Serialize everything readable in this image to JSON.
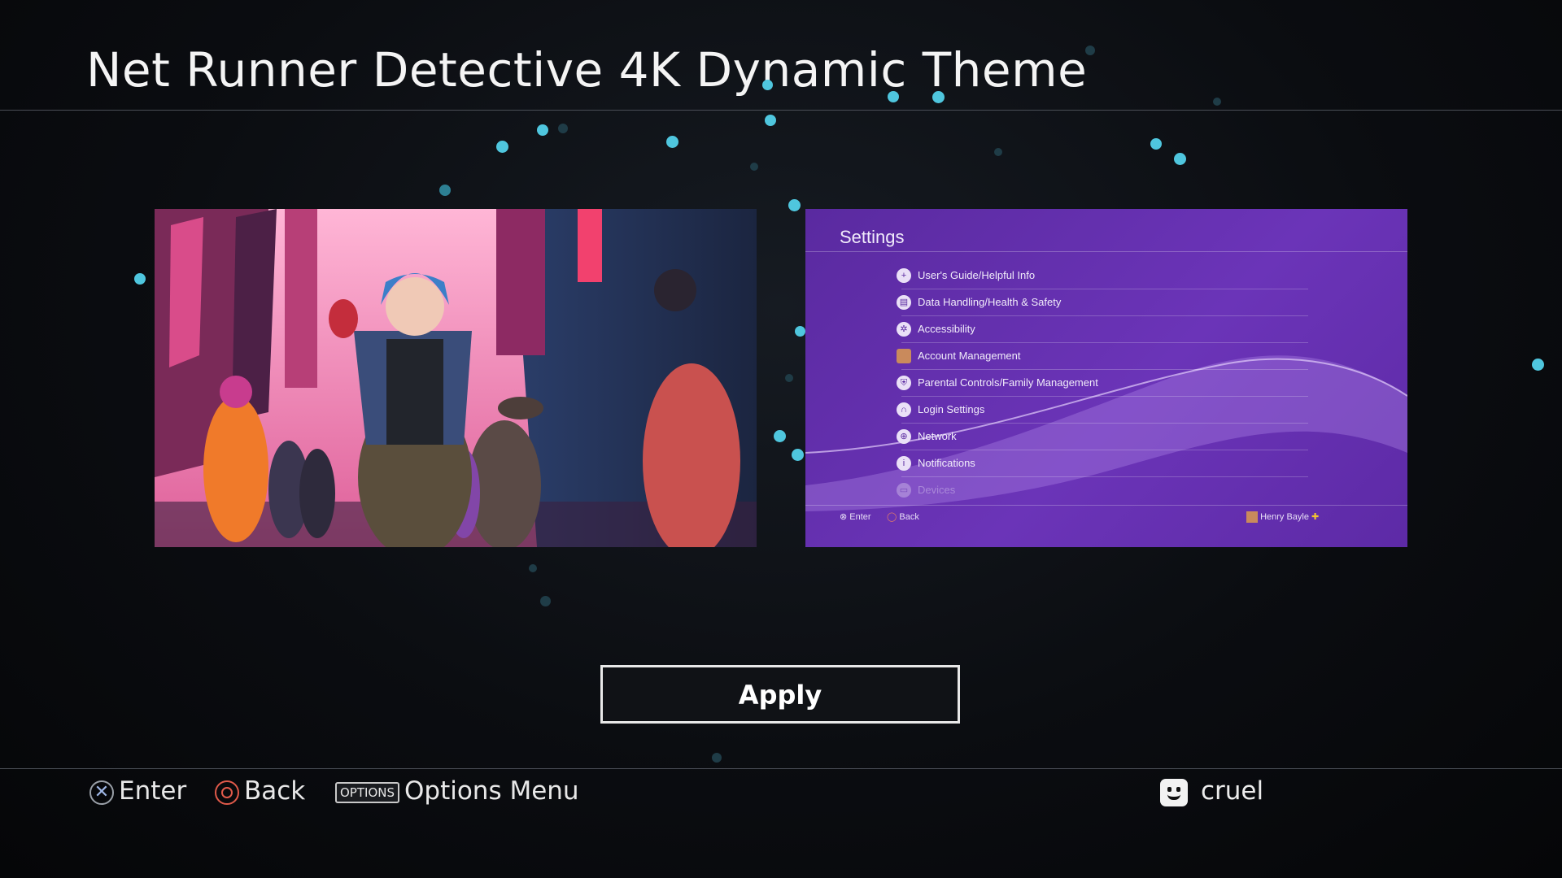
{
  "header": {
    "title": "Net Runner Detective 4K Dynamic Theme"
  },
  "preview": {
    "title": "Settings",
    "items": [
      {
        "icon": "users-guide-icon",
        "label": "User's Guide/Helpful Info"
      },
      {
        "icon": "data-handling-icon",
        "label": "Data Handling/Health & Safety"
      },
      {
        "icon": "accessibility-icon",
        "label": "Accessibility"
      },
      {
        "icon": "account-icon",
        "label": "Account Management"
      },
      {
        "icon": "parental-controls-icon",
        "label": "Parental Controls/Family Management"
      },
      {
        "icon": "login-icon",
        "label": "Login Settings"
      },
      {
        "icon": "network-icon",
        "label": "Network"
      },
      {
        "icon": "notifications-icon",
        "label": "Notifications"
      },
      {
        "icon": "devices-icon",
        "label": "Devices"
      }
    ],
    "footer": {
      "enter": "Enter",
      "back": "Back",
      "user": "Henry Bayle"
    }
  },
  "actions": {
    "apply_label": "Apply"
  },
  "footer": {
    "enter_label": "Enter",
    "back_label": "Back",
    "options_glyph": "OPTIONS",
    "options_label": "Options Menu",
    "username": "cruel"
  },
  "colors": {
    "particle": "#4fc6de",
    "preview_purple": "#6b34b8",
    "artwork_pink": "#e46fa7",
    "circle_button": "#e05a4a"
  }
}
